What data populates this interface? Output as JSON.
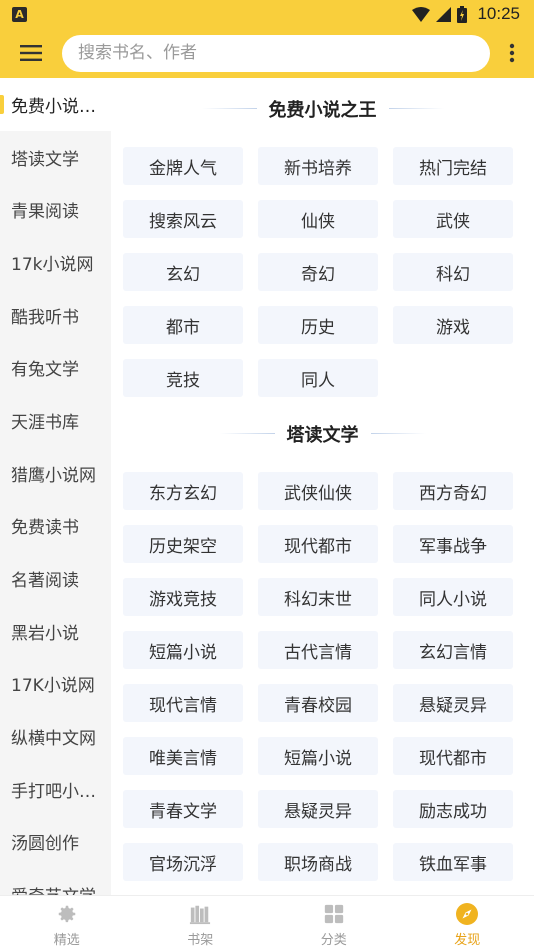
{
  "status_bar": {
    "app_icon_letter": "A",
    "time": "10:25"
  },
  "search": {
    "placeholder": "搜索书名、作者"
  },
  "sidebar": {
    "items": [
      {
        "label": "免费小说之王",
        "active": true
      },
      {
        "label": "塔读文学"
      },
      {
        "label": "青果阅读"
      },
      {
        "label": "17k小说网"
      },
      {
        "label": "酷我听书"
      },
      {
        "label": "有兔文学"
      },
      {
        "label": "天涯书库"
      },
      {
        "label": "猎鹰小说网"
      },
      {
        "label": "免费读书"
      },
      {
        "label": "名著阅读"
      },
      {
        "label": "黑岩小说"
      },
      {
        "label": "17K小说网"
      },
      {
        "label": "纵横中文网"
      },
      {
        "label": "手打吧小说网"
      },
      {
        "label": "汤圆创作"
      },
      {
        "label": "爱奇艺文学"
      }
    ]
  },
  "sections": [
    {
      "title": "免费小说之王",
      "tags": [
        "金牌人气",
        "新书培养",
        "热门完结",
        "搜索风云",
        "仙侠",
        "武侠",
        "玄幻",
        "奇幻",
        "科幻",
        "都市",
        "历史",
        "游戏",
        "竞技",
        "同人"
      ]
    },
    {
      "title": "塔读文学",
      "tags": [
        "东方玄幻",
        "武侠仙侠",
        "西方奇幻",
        "历史架空",
        "现代都市",
        "军事战争",
        "游戏竞技",
        "科幻末世",
        "同人小说",
        "短篇小说",
        "古代言情",
        "玄幻言情",
        "现代言情",
        "青春校园",
        "悬疑灵异",
        "唯美言情",
        "短篇小说",
        "现代都市",
        "青春文学",
        "悬疑灵异",
        "励志成功",
        "官场沉浮",
        "职场商战",
        "铁血军事"
      ]
    }
  ],
  "bottom_nav": {
    "items": [
      {
        "label": "精选",
        "icon": "gear-icon"
      },
      {
        "label": "书架",
        "icon": "bookshelf-icon"
      },
      {
        "label": "分类",
        "icon": "grid-icon"
      },
      {
        "label": "发现",
        "icon": "compass-icon",
        "active": true
      }
    ]
  },
  "colors": {
    "accent": "#f9cf3c",
    "active_nav": "#e8a319",
    "tag_bg": "#f3f6fc"
  }
}
